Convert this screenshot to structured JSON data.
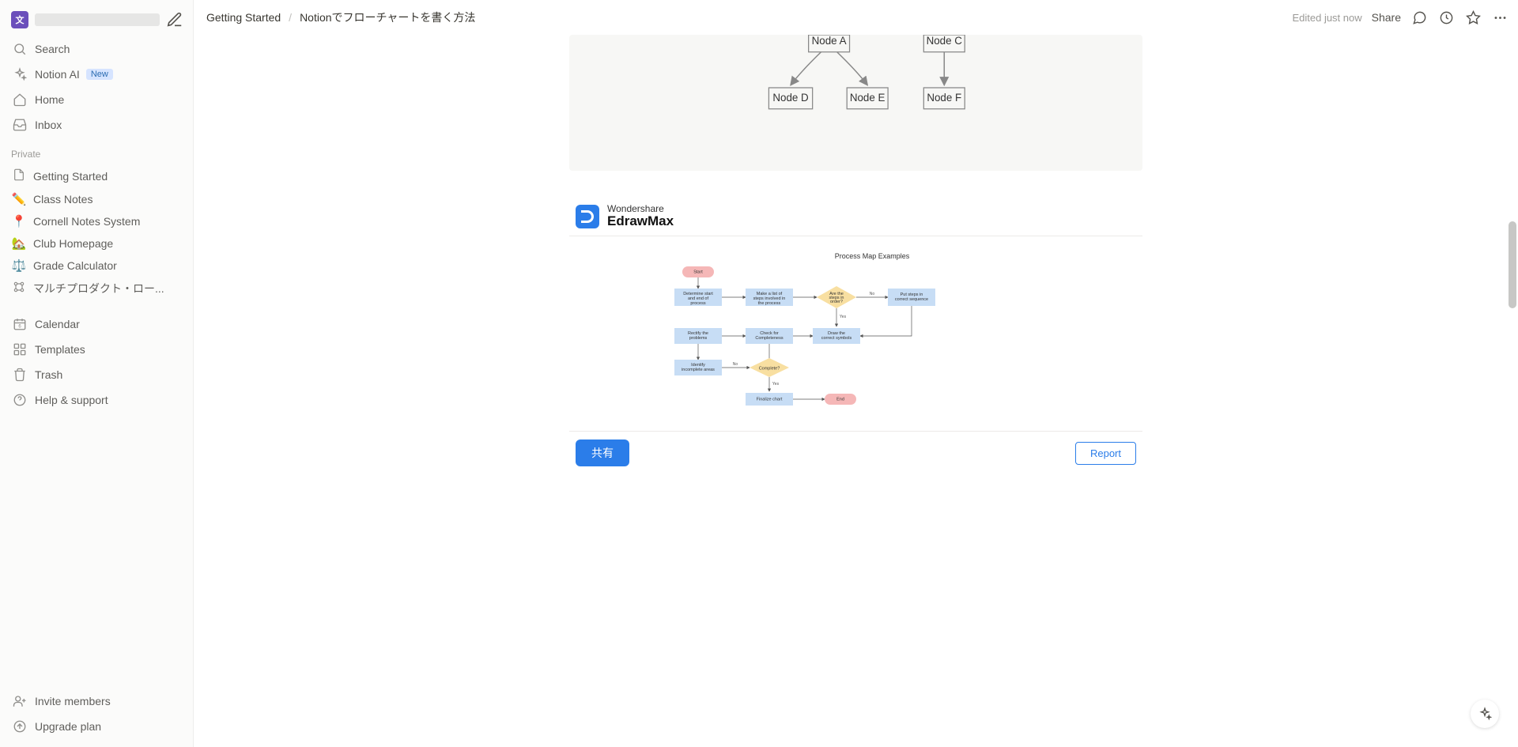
{
  "workspace": {
    "icon_letter": "文"
  },
  "sidebar": {
    "search": "Search",
    "notion_ai": "Notion AI",
    "new_badge": "New",
    "home": "Home",
    "inbox": "Inbox",
    "private_label": "Private",
    "pages": [
      {
        "icon": "📄",
        "label": "Getting Started"
      },
      {
        "icon": "✏️",
        "label": "Class Notes"
      },
      {
        "icon": "📍",
        "label": "Cornell Notes System"
      },
      {
        "icon": "🏡",
        "label": "Club Homepage"
      },
      {
        "icon": "⚖️",
        "label": "Grade Calculator"
      },
      {
        "icon": "🔀",
        "label": "マルチプロダクト・ロー..."
      }
    ],
    "calendar": "Calendar",
    "templates": "Templates",
    "trash": "Trash",
    "help": "Help & support",
    "invite": "Invite members",
    "upgrade": "Upgrade plan"
  },
  "breadcrumb": {
    "a": "Getting Started",
    "b": "Notionでフローチャートを書く方法"
  },
  "topbar": {
    "edited": "Edited just now",
    "share": "Share"
  },
  "node_diagram": {
    "nodes": [
      "Node A",
      "Node C",
      "Node D",
      "Node E",
      "Node F"
    ]
  },
  "edraw": {
    "brand1": "Wondershare",
    "brand2": "EdrawMax",
    "title": "Process Map Examples",
    "boxes": {
      "start": "Start",
      "determine": "Determine start and end of process",
      "makelist": "Make a list of steps involved in the process",
      "order": "Are the steps in order?",
      "sequence": "Put steps in correct sequence",
      "rectify": "Rectify the problems",
      "check": "Check for Completeness",
      "symbols": "Draw the correct symbols",
      "identify": "Identify incomplete areas",
      "complete": "Complete?",
      "finalize": "Finalize chart",
      "end": "End",
      "yes": "Yes",
      "no": "No"
    },
    "share_btn": "共有",
    "report_btn": "Report"
  }
}
